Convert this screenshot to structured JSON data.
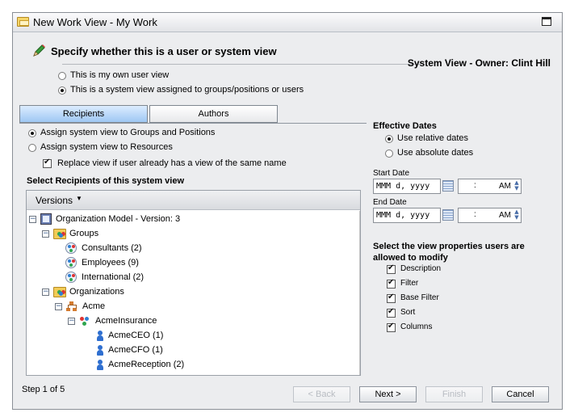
{
  "window": {
    "title": "New Work View - My Work"
  },
  "header": {
    "heading": "Specify whether this is a user or system view",
    "owner": "System View - Owner: Clint Hill"
  },
  "view_type": {
    "options": [
      "This is my own user view",
      "This is a system view assigned to groups/positions or users"
    ],
    "selected_index": 1
  },
  "tabs": [
    {
      "label": "Recipients",
      "active": true
    },
    {
      "label": "Authors",
      "active": false
    }
  ],
  "recipients": {
    "assign_options": [
      "Assign system view to Groups and Positions",
      "Assign system view to Resources"
    ],
    "assign_selected_index": 0,
    "replace_checkbox_label": "Replace view if user already has a view of the same name",
    "replace_checked": true,
    "section_title": "Select Recipients of this system view",
    "versions_label": "Versions"
  },
  "tree": [
    {
      "label": "Organization Model - Version: 3",
      "icon": "org-model-icon",
      "expander": "minus"
    },
    {
      "label": "Groups",
      "icon": "folder-groups-icon",
      "expander": "minus"
    },
    {
      "label": "Consultants  (2)",
      "icon": "group-icon"
    },
    {
      "label": "Employees  (9)",
      "icon": "group-icon"
    },
    {
      "label": "International  (2)",
      "icon": "group-icon"
    },
    {
      "label": "Organizations",
      "icon": "folder-org-icon",
      "expander": "minus"
    },
    {
      "label": "Acme",
      "icon": "hierarchy-icon",
      "expander": "minus"
    },
    {
      "label": "AcmeInsurance",
      "icon": "company-icon",
      "expander": "minus"
    },
    {
      "label": "AcmeCEO  (1)",
      "icon": "person-icon"
    },
    {
      "label": "AcmeCFO  (1)",
      "icon": "person-icon"
    },
    {
      "label": "AcmeReception  (2)",
      "icon": "person-icon"
    }
  ],
  "effective_dates": {
    "title": "Effective Dates",
    "options": [
      "Use relative dates",
      "Use absolute dates"
    ],
    "selected_index": 0,
    "start_label": "Start Date",
    "end_label": "End Date",
    "date_placeholder": "MMM d, yyyy",
    "time_colon": ":",
    "time_ampm": "AM"
  },
  "view_properties": {
    "title": "Select the view properties users are allowed to modify",
    "items": [
      {
        "label": "Description",
        "checked": true
      },
      {
        "label": "Filter",
        "checked": true
      },
      {
        "label": "Base Filter",
        "checked": true
      },
      {
        "label": "Sort",
        "checked": true
      },
      {
        "label": "Columns",
        "checked": true
      }
    ]
  },
  "footer": {
    "step": "Step 1 of 5",
    "back": "< Back",
    "next": "Next >",
    "finish": "Finish",
    "cancel": "Cancel"
  },
  "colors": {
    "tab_active": "#9ec7f3",
    "dialog_bg": "#ecedef"
  }
}
